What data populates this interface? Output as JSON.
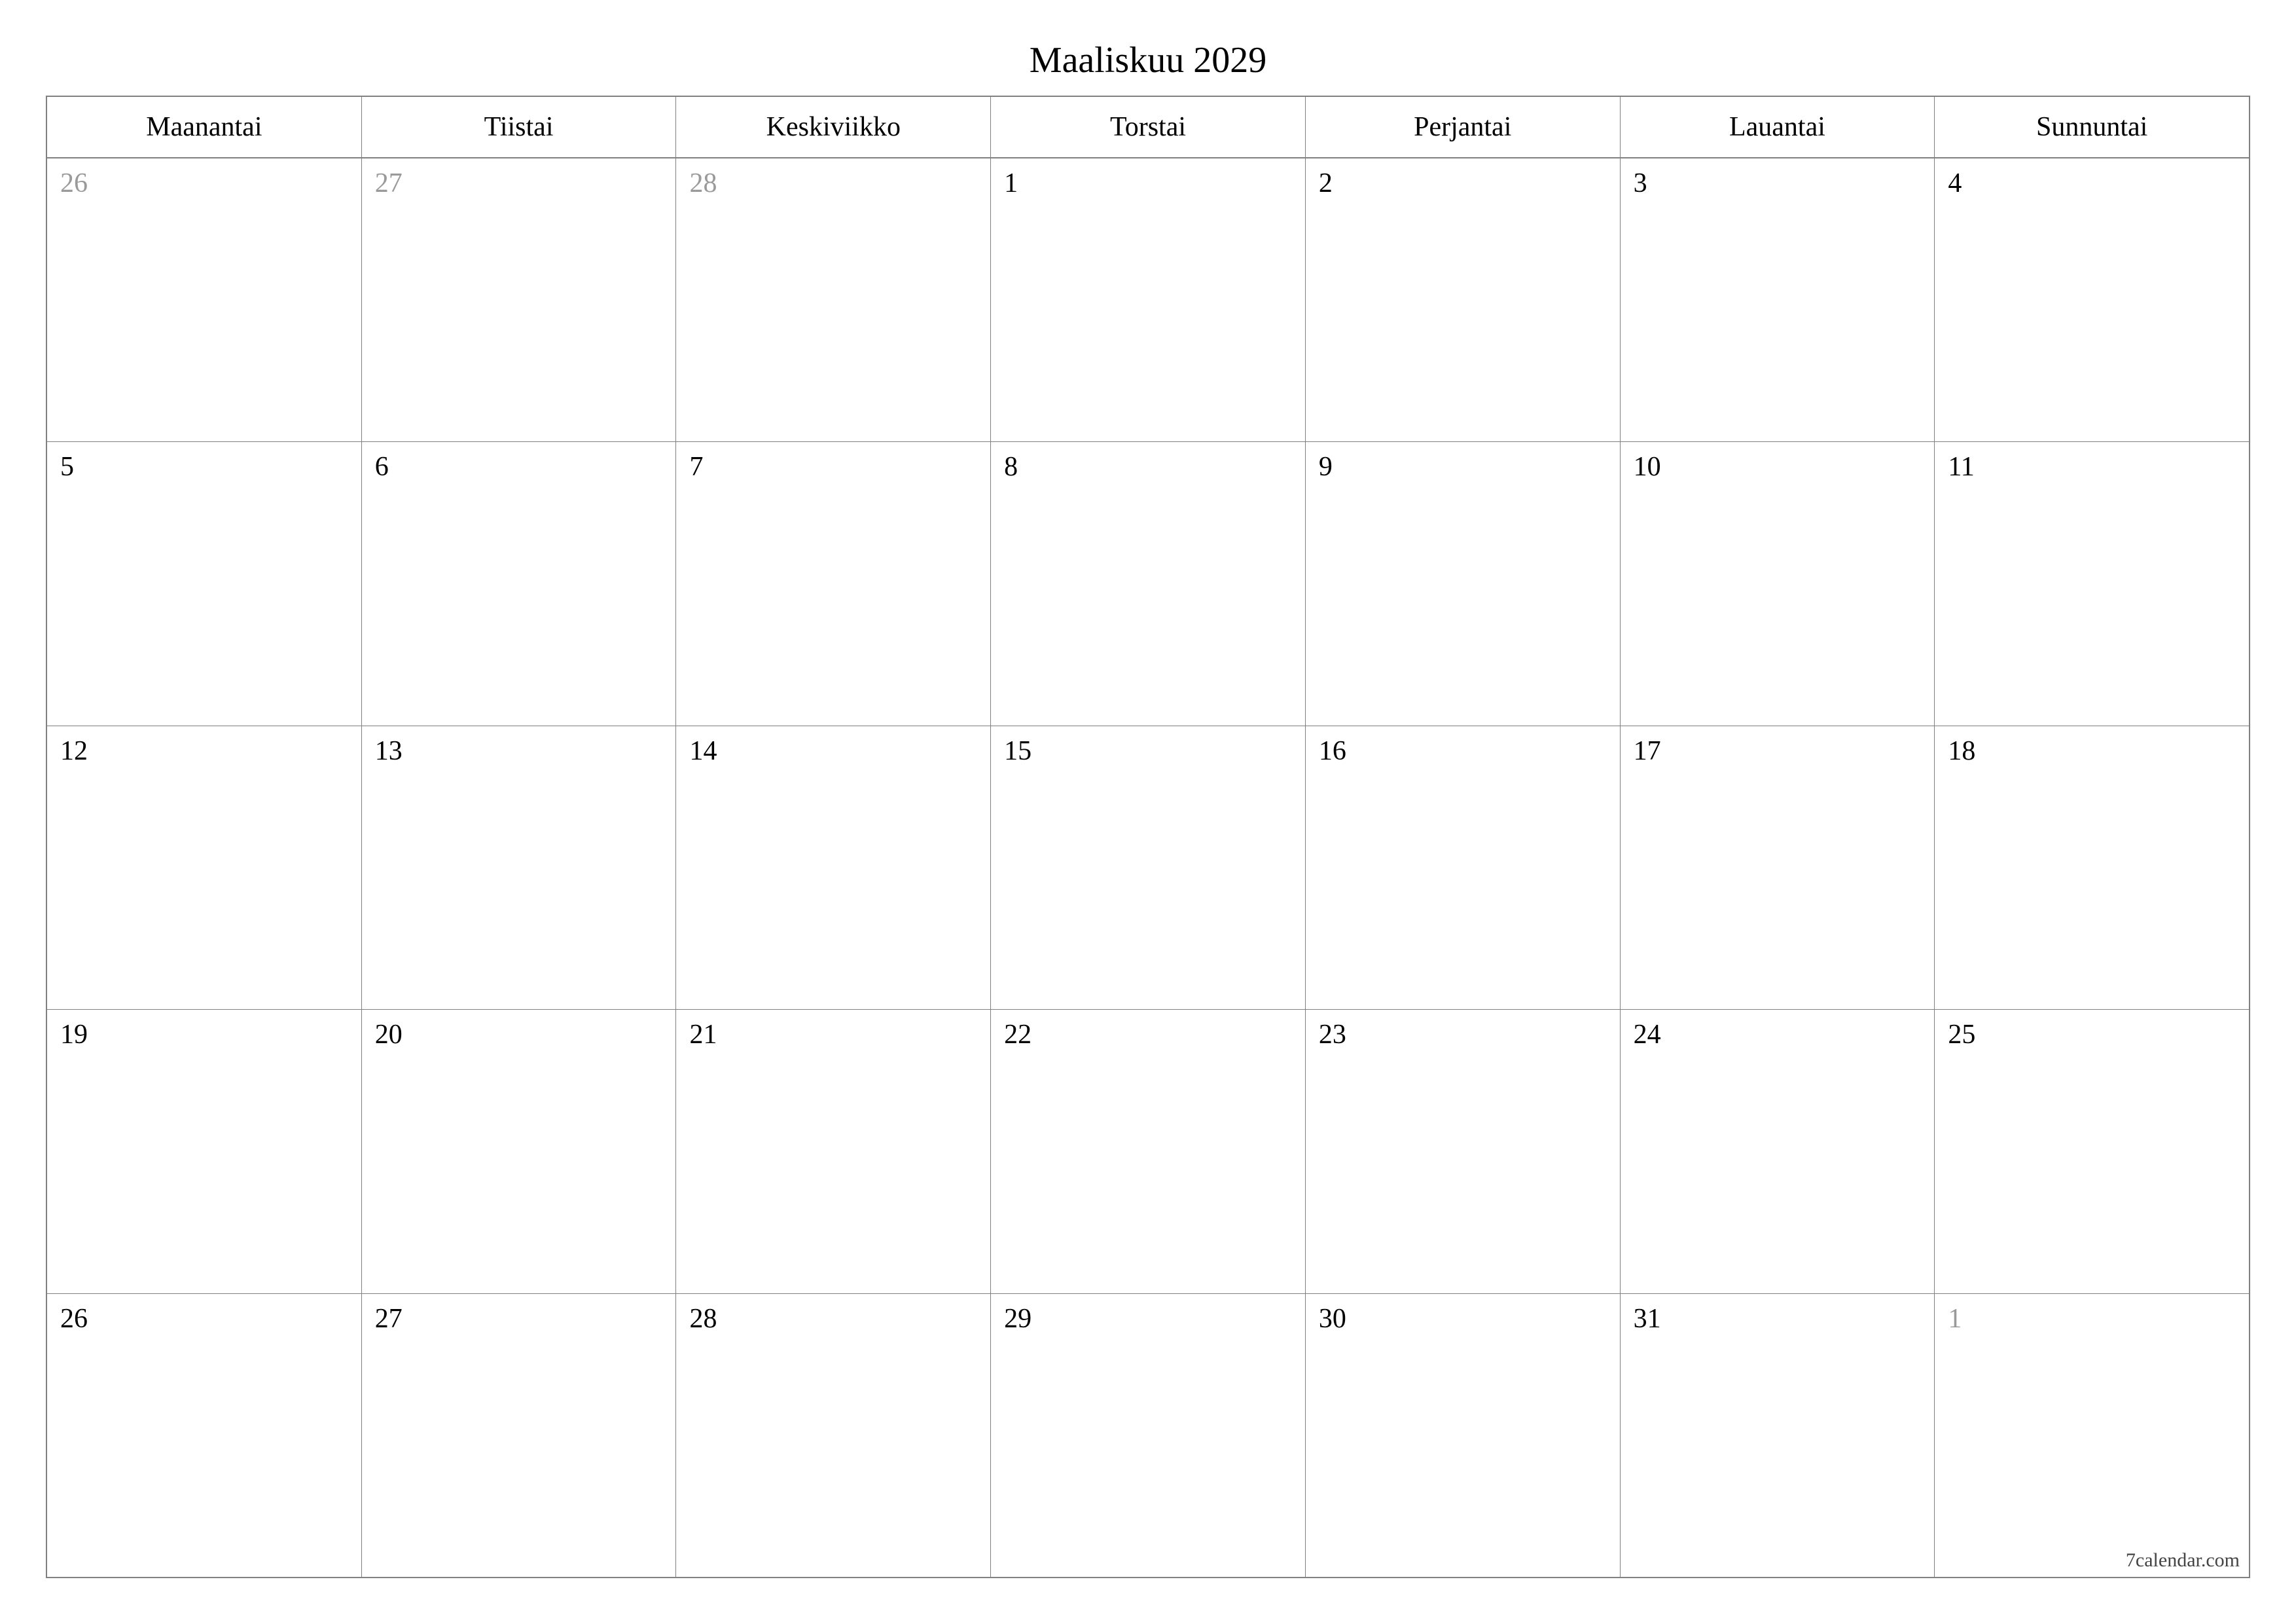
{
  "title": "Maaliskuu 2029",
  "credit": "7calendar.com",
  "weekdays": [
    "Maanantai",
    "Tiistai",
    "Keskiviikko",
    "Torstai",
    "Perjantai",
    "Lauantai",
    "Sunnuntai"
  ],
  "weeks": [
    [
      {
        "n": "26",
        "outside": true
      },
      {
        "n": "27",
        "outside": true
      },
      {
        "n": "28",
        "outside": true
      },
      {
        "n": "1",
        "outside": false
      },
      {
        "n": "2",
        "outside": false
      },
      {
        "n": "3",
        "outside": false
      },
      {
        "n": "4",
        "outside": false
      }
    ],
    [
      {
        "n": "5",
        "outside": false
      },
      {
        "n": "6",
        "outside": false
      },
      {
        "n": "7",
        "outside": false
      },
      {
        "n": "8",
        "outside": false
      },
      {
        "n": "9",
        "outside": false
      },
      {
        "n": "10",
        "outside": false
      },
      {
        "n": "11",
        "outside": false
      }
    ],
    [
      {
        "n": "12",
        "outside": false
      },
      {
        "n": "13",
        "outside": false
      },
      {
        "n": "14",
        "outside": false
      },
      {
        "n": "15",
        "outside": false
      },
      {
        "n": "16",
        "outside": false
      },
      {
        "n": "17",
        "outside": false
      },
      {
        "n": "18",
        "outside": false
      }
    ],
    [
      {
        "n": "19",
        "outside": false
      },
      {
        "n": "20",
        "outside": false
      },
      {
        "n": "21",
        "outside": false
      },
      {
        "n": "22",
        "outside": false
      },
      {
        "n": "23",
        "outside": false
      },
      {
        "n": "24",
        "outside": false
      },
      {
        "n": "25",
        "outside": false
      }
    ],
    [
      {
        "n": "26",
        "outside": false
      },
      {
        "n": "27",
        "outside": false
      },
      {
        "n": "28",
        "outside": false
      },
      {
        "n": "29",
        "outside": false
      },
      {
        "n": "30",
        "outside": false
      },
      {
        "n": "31",
        "outside": false
      },
      {
        "n": "1",
        "outside": true
      }
    ]
  ]
}
